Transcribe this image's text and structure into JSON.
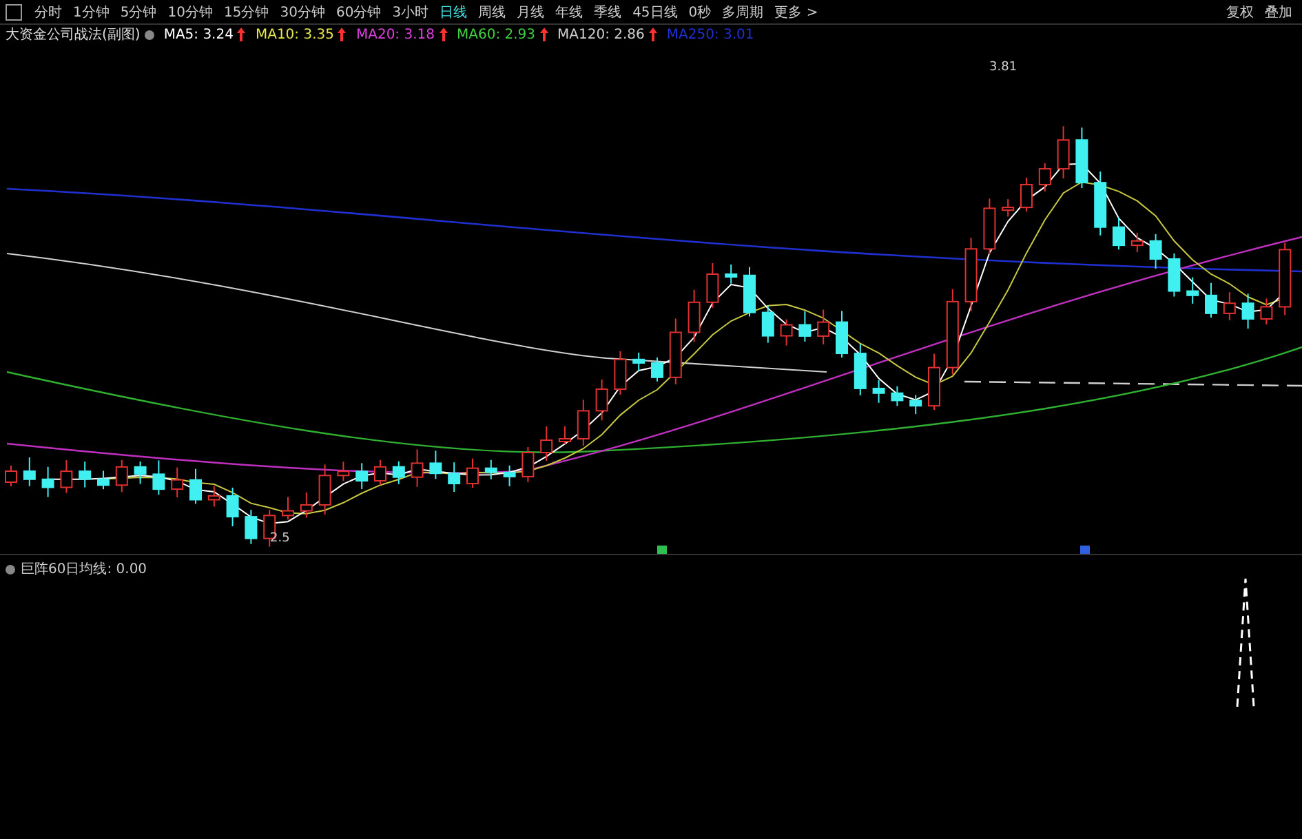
{
  "toolbar": {
    "tabs": [
      {
        "label": "分时",
        "selected": false
      },
      {
        "label": "1分钟",
        "selected": false
      },
      {
        "label": "5分钟",
        "selected": false
      },
      {
        "label": "10分钟",
        "selected": false
      },
      {
        "label": "15分钟",
        "selected": false
      },
      {
        "label": "30分钟",
        "selected": false
      },
      {
        "label": "60分钟",
        "selected": false
      },
      {
        "label": "3小时",
        "selected": false
      },
      {
        "label": "日线",
        "selected": true
      },
      {
        "label": "周线",
        "selected": false
      },
      {
        "label": "月线",
        "selected": false
      },
      {
        "label": "年线",
        "selected": false
      },
      {
        "label": "季线",
        "selected": false
      },
      {
        "label": "45日线",
        "selected": false
      },
      {
        "label": "0秒",
        "selected": false
      },
      {
        "label": "多周期",
        "selected": false
      },
      {
        "label": "更多 >",
        "selected": false
      }
    ],
    "right_buttons": [
      "复权",
      "叠加"
    ]
  },
  "main_chart": {
    "indicator": "大资金公司战法(副图)",
    "averages": [
      {
        "name": "MA5:",
        "value": "3.24",
        "up": true,
        "color": "#ffffff"
      },
      {
        "name": "MA10:",
        "value": "3.35",
        "up": true,
        "color": "#e8e84a"
      },
      {
        "name": "MA20:",
        "value": "3.18",
        "up": true,
        "color": "#e040e0"
      },
      {
        "name": "MA60:",
        "value": "2.93",
        "up": true,
        "color": "#40d040"
      },
      {
        "name": "MA120:",
        "value": "2.86",
        "up": true,
        "color": "#d0d0d0"
      },
      {
        "name": "MA250:",
        "value": "3.01",
        "up": false,
        "color": "#2030d0"
      }
    ],
    "high_label": "3.81",
    "low_label": "2.5"
  },
  "sub_chart": {
    "name": "巨阵60日均线:",
    "value": "0.00"
  }
}
